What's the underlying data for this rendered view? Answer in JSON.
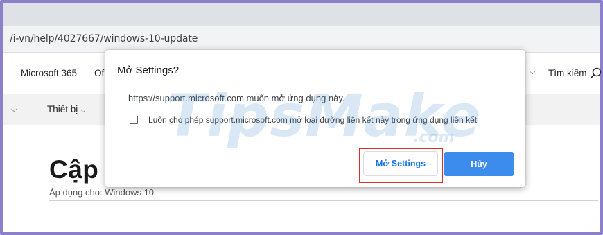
{
  "browser": {
    "url": "/i-vn/help/4027667/windows-10-update"
  },
  "site_nav": {
    "brand": "Microsoft 365",
    "truncated_item": "Of",
    "search_label": "Tìm kiếm",
    "secondary": {
      "devices_label": "Thiết bị"
    }
  },
  "article": {
    "title": "Cập n",
    "applies_to": "Áp dụng cho: Windows 10"
  },
  "dialog": {
    "title": "Mở Settings?",
    "message": "https://support.microsoft.com muốn mở ứng dụng này.",
    "checkbox_label": "Luôn cho phép support.microsoft.com mở loại đường liên kết này trong ứng dụng liên kết",
    "checkbox_checked": false,
    "open_button": "Mở Settings",
    "cancel_button": "Hủy",
    "primary_color": "#3b8ced",
    "highlight_color": "#d93025"
  },
  "watermark": {
    "text": "TipsMake",
    "suffix": ".com"
  }
}
